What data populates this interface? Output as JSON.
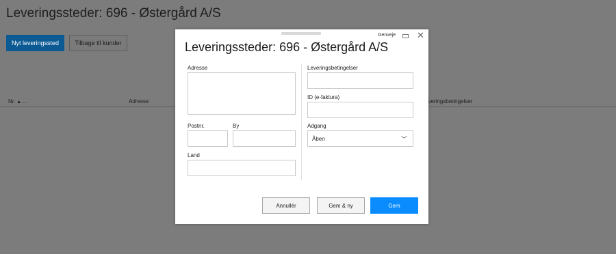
{
  "page": {
    "title": "Leveringssteder: 696 - Østergård A/S",
    "buttons": {
      "new": "Nyt leveringssted",
      "back": "Tilbage til kunder"
    },
    "table": {
      "columns": [
        "Nr.",
        "Adresse",
        "everingsbetingelser"
      ],
      "sort_suffix": "..."
    }
  },
  "modal": {
    "shortcuts": "Genveje",
    "title": "Leveringssteder: 696 - Østergård A/S",
    "fields": {
      "address": {
        "label": "Adresse",
        "value": ""
      },
      "zip": {
        "label": "Postnr.",
        "value": ""
      },
      "city": {
        "label": "By",
        "value": ""
      },
      "country": {
        "label": "Land",
        "value": ""
      },
      "terms": {
        "label": "Leveringsbetingelser",
        "value": ""
      },
      "einvoice": {
        "label": "ID (e-faktura)",
        "value": ""
      },
      "access": {
        "label": "Adgang",
        "value": "Åben"
      }
    },
    "buttons": {
      "cancel": "Annullér",
      "save_new": "Gem & ny",
      "save": "Gem"
    }
  },
  "colors": {
    "primary": "#0a8cff",
    "overlay": "#7c7c7c"
  }
}
